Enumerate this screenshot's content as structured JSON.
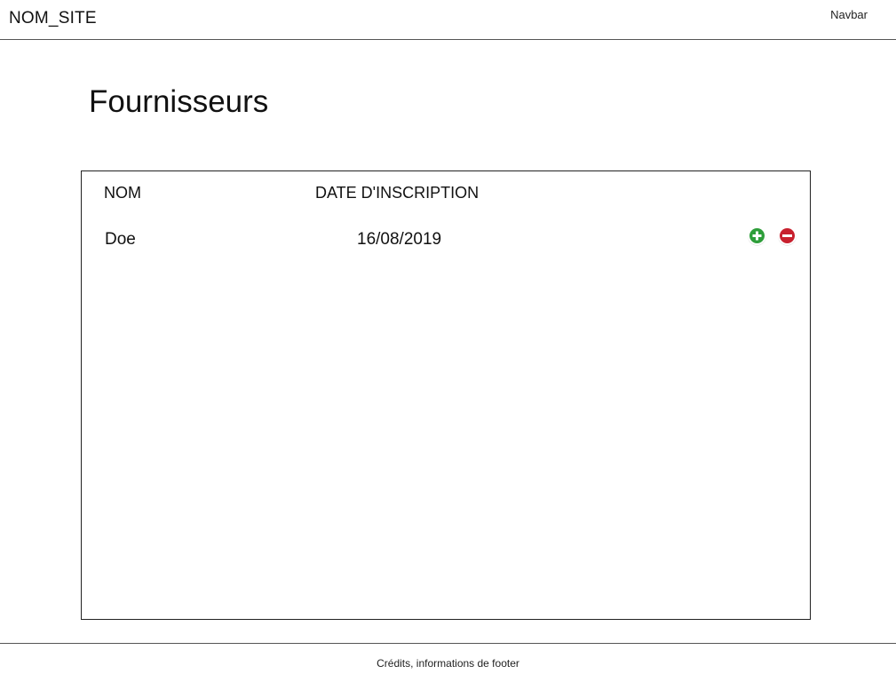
{
  "header": {
    "site_name": "NOM_SITE",
    "navbar_label": "Navbar"
  },
  "main": {
    "title": "Fournisseurs",
    "table": {
      "columns": [
        "NOM",
        "DATE D'INSCRIPTION"
      ],
      "rows": [
        {
          "nom": "Doe",
          "date_inscription": "16/08/2019"
        }
      ],
      "actions": [
        {
          "name": "add",
          "icon": "plus-circle-icon",
          "color": "#2e9e3a"
        },
        {
          "name": "remove",
          "icon": "minus-circle-icon",
          "color": "#c8202e"
        }
      ]
    }
  },
  "footer": {
    "text": "Crédits, informations de footer"
  }
}
